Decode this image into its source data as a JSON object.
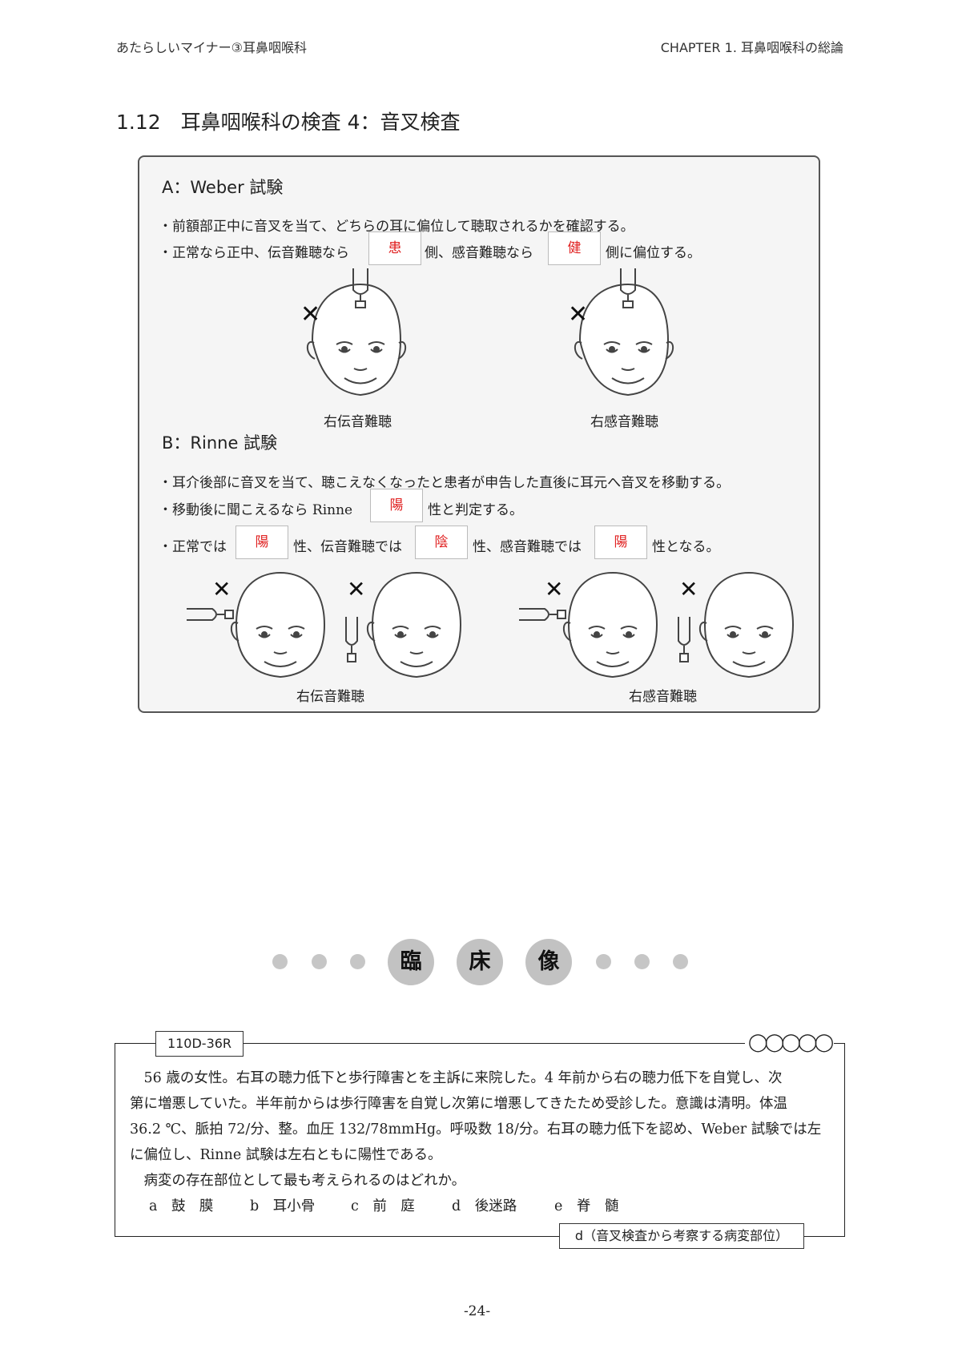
{
  "header": {
    "left": "あたらしいマイナー③耳鼻咽喉科",
    "right": "CHAPTER 1. 耳鼻咽喉科の総論"
  },
  "section_title": "1.12　耳鼻咽喉科の検査 4：音叉検査",
  "weber": {
    "title": "A：Weber 試験",
    "line1": "・前額部正中に音叉を当て、どちらの耳に偏位して聴取されるかを確認する。",
    "line2_a": "・正常なら正中、伝音難聴なら",
    "blank1": "患",
    "line2_b": "側、感音難聴なら",
    "blank2": "健",
    "line2_c": "側に偏位する。",
    "caption_left": "右伝音難聴",
    "caption_right": "右感音難聴"
  },
  "rinne": {
    "title": "B：Rinne 試験",
    "line1": "・耳介後部に音叉を当て、聴こえなくなったと患者が申告した直後に耳元へ音叉を移動する。",
    "line2_a": "・移動後に聞こえるなら Rinne",
    "blank1": "陽",
    "line2_b": "性と判定する。",
    "line3_a": "・正常では",
    "blank2": "陽",
    "line3_b": "性、伝音難聴では",
    "blank3": "陰",
    "line3_c": "性、感音難聴では",
    "blank4": "陽",
    "line3_d": "性となる。",
    "caption_left": "右伝音難聴",
    "caption_right": "右感音難聴"
  },
  "banner": {
    "chars": [
      "臨",
      "床",
      "像"
    ]
  },
  "question": {
    "id": "110D-36R",
    "rating": "◯◯◯◯◯",
    "lines": [
      "　56 歳の女性。右耳の聴力低下と歩行障害とを主訴に来院した。4 年前から右の聴力低下を自覚し、次",
      "第に増悪していた。半年前からは歩行障害を自覚し次第に増悪してきたため受診した。意識は清明。体温",
      "36.2 ℃、脈拍 72/分、整。血圧 132/78mmHg。呼吸数 18/分。右耳の聴力低下を認め、Weber 試験では左",
      "に偏位し、Rinne 試験は左右ともに陽性である。",
      "　病変の存在部位として最も考えられるのはどれか。"
    ],
    "choices": [
      {
        "letter": "a",
        "text": "鼓　膜"
      },
      {
        "letter": "b",
        "text": "耳小骨"
      },
      {
        "letter": "c",
        "text": "前　庭"
      },
      {
        "letter": "d",
        "text": "後迷路"
      },
      {
        "letter": "e",
        "text": "脊　髄"
      }
    ],
    "answer": "d（音叉検査から考察する病変部位）"
  },
  "page_number": "-24-"
}
